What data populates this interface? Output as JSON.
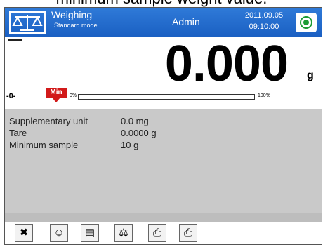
{
  "caption": "minimum sample weight value.",
  "header": {
    "title": "Weighing",
    "mode": "Standard mode",
    "user": "Admin",
    "date": "2011.09.05",
    "time": "09:10:00",
    "accent_color": "#1a5fc2"
  },
  "display": {
    "reading": "0.000",
    "unit": "g",
    "zero_indicator": "-0-",
    "min_flag": "Min",
    "bar_start_label": "0%",
    "bar_end_label": "100%",
    "progress_fraction": 0.0
  },
  "info": {
    "rows": [
      {
        "label": "Supplementary unit",
        "value": "0.0 mg"
      },
      {
        "label": "Tare",
        "value": "0.0000 g"
      },
      {
        "label": "Minimum sample",
        "value": "10 g"
      }
    ]
  },
  "toolbar": {
    "icons": [
      "tools-icon",
      "user-icon",
      "document-icon",
      "weights-icon",
      "printer-icon",
      "printer-header-icon"
    ]
  }
}
